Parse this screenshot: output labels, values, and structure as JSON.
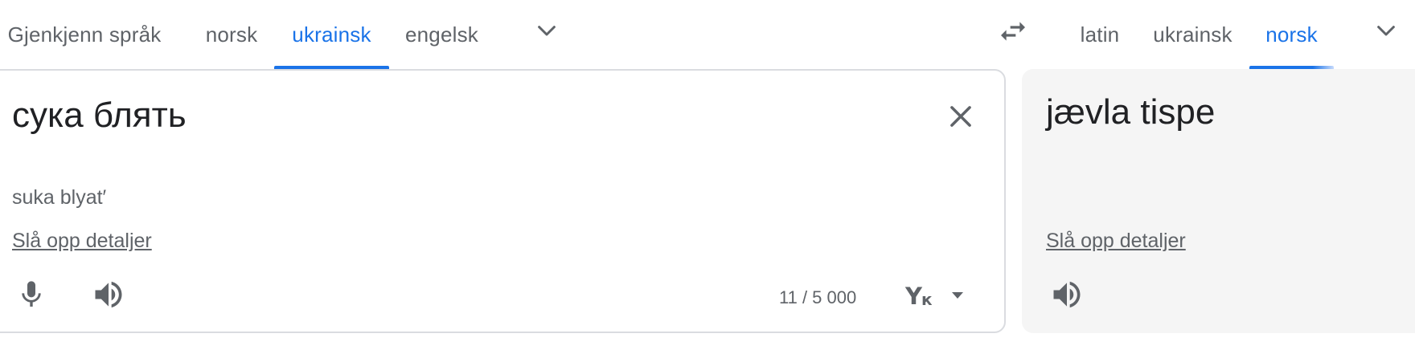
{
  "source_languages": {
    "tabs": [
      {
        "label": "Gjenkjenn språk",
        "active": false
      },
      {
        "label": "norsk",
        "active": false
      },
      {
        "label": "ukrainsk",
        "active": true
      },
      {
        "label": "engelsk",
        "active": false
      }
    ],
    "more_icon": "chevron-down-icon"
  },
  "swap_icon": "swap-arrows-icon",
  "target_languages": {
    "tabs": [
      {
        "label": "latin",
        "active": false
      },
      {
        "label": "ukrainsk",
        "active": false
      },
      {
        "label": "norsk",
        "active": true
      }
    ],
    "more_icon": "chevron-down-icon"
  },
  "source": {
    "text": "сука блять",
    "transliteration": "suka blyat′",
    "lookup_link": "Slå opp detaljer",
    "char_count": "11 / 5 000",
    "clear_icon": "close-icon",
    "mic_icon": "microphone-icon",
    "listen_icon": "speaker-icon",
    "keyboard_icon": "keyboard-layout-icon"
  },
  "target": {
    "text": "jævla tispe",
    "lookup_link": "Slå opp detaljer",
    "listen_icon": "speaker-icon"
  },
  "colors": {
    "accent": "#1a73e8",
    "text_primary": "#202124",
    "text_secondary": "#5f6368",
    "border": "#dadce0",
    "target_bg": "#f5f5f5"
  }
}
